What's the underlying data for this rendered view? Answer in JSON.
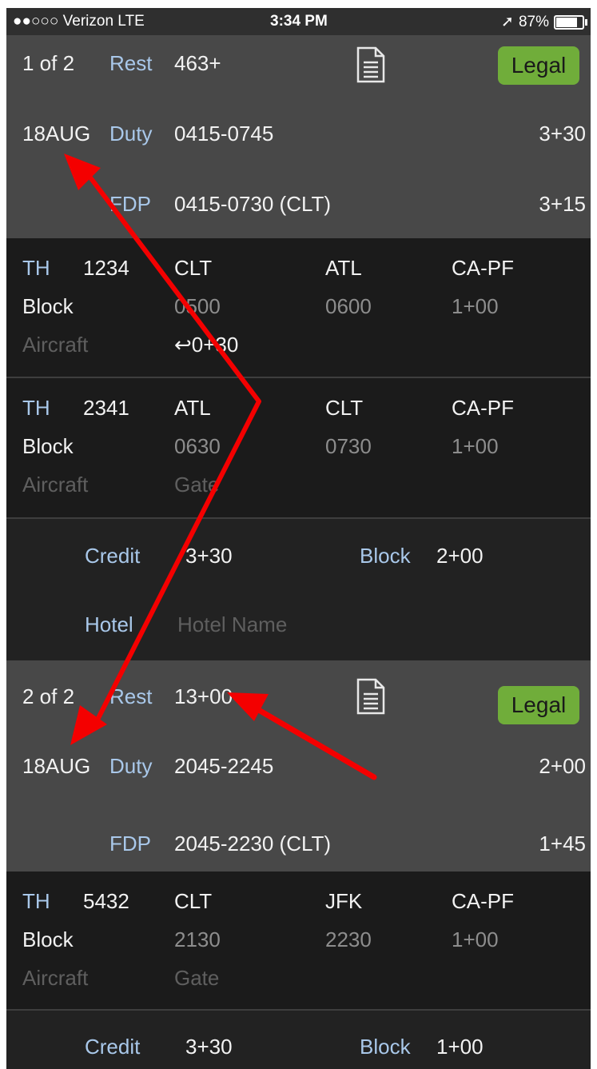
{
  "status_bar": {
    "carrier": "●●○○○ Verizon  LTE",
    "time": "3:34 PM",
    "battery": "87%",
    "battery_level": 0.87
  },
  "duty_periods": [
    {
      "index_label": "1 of 2",
      "rest_label": "Rest",
      "rest_value": "463+",
      "legal_label": "Legal",
      "date": "18AUG",
      "duty_label": "Duty",
      "duty_time": "0415-0745",
      "duty_total": "3+30",
      "fdp_label": "FDP",
      "fdp_time": "0415-0730 (CLT)",
      "fdp_total": "3+15"
    },
    {
      "index_label": "2 of 2",
      "rest_label": "Rest",
      "rest_value": "13+00",
      "legal_label": "Legal",
      "date": "18AUG",
      "duty_label": "Duty",
      "duty_time": "2045-2245",
      "duty_total": "2+00",
      "fdp_label": "FDP",
      "fdp_time": "2045-2230 (CLT)",
      "fdp_total": "1+45"
    }
  ],
  "legs": [
    {
      "airline": "TH",
      "flight": "1234",
      "from": "CLT",
      "to": "ATL",
      "position": "CA-PF",
      "block_label": "Block",
      "out": "0500",
      "in": "0600",
      "block_time": "1+00",
      "aircraft_label": "Aircraft",
      "extra": "↩0+30"
    },
    {
      "airline": "TH",
      "flight": "2341",
      "from": "ATL",
      "to": "CLT",
      "position": "CA-PF",
      "block_label": "Block",
      "out": "0630",
      "in": "0730",
      "block_time": "1+00",
      "aircraft_label": "Aircraft",
      "extra": "Gate"
    },
    {
      "airline": "TH",
      "flight": "5432",
      "from": "CLT",
      "to": "JFK",
      "position": "CA-PF",
      "block_label": "Block",
      "out": "2130",
      "in": "2230",
      "block_time": "1+00",
      "aircraft_label": "Aircraft",
      "extra": "Gate"
    }
  ],
  "summaries": [
    {
      "credit_label": "Credit",
      "credit_value": "3+30",
      "block_label": "Block",
      "block_value": "2+00",
      "hotel_label": "Hotel",
      "hotel_placeholder": "Hotel Name"
    },
    {
      "credit_label": "Credit",
      "credit_value": "3+30",
      "block_label": "Block",
      "block_value": "1+00"
    }
  ],
  "colors": {
    "header_bg": "#484848",
    "leg_bg": "#1b1b1b",
    "label_blue": "#a9c8ea",
    "legal_green": "#70ad3a",
    "arrow_red": "#f40000"
  },
  "icons": [
    "document-icon",
    "location-arrow-icon",
    "battery-icon"
  ]
}
